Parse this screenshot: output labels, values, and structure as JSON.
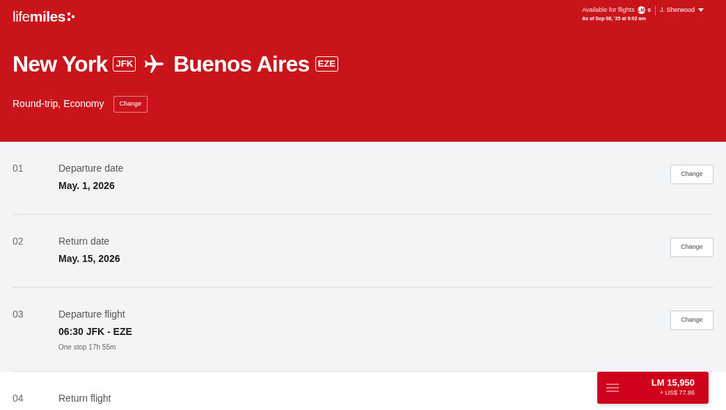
{
  "logo": "life**miles**",
  "account": {
    "availability_label": "Available for flights",
    "badge": "LM",
    "balance": "0",
    "as_of": "As of Sep 08, '25 at 9:02 am",
    "user": "J. Sherwood"
  },
  "route": {
    "origin": "New York",
    "origin_code": "JFK",
    "destination": "Buenos Aires",
    "destination_code": "EZE"
  },
  "trip": {
    "summary": "Round-trip, Economy",
    "button": "Change"
  },
  "steps": [
    {
      "number": "01",
      "title": "Departure date",
      "value": "May. 1, 2026",
      "completed": true,
      "button": "Change"
    },
    {
      "number": "02",
      "title": "Return date",
      "value": "May. 15, 2026",
      "completed": true,
      "button": "Change"
    },
    {
      "number": "03",
      "title": "Departure flight",
      "value": "06:30 JFK - EZE",
      "detail": "One stop 17h 55m",
      "completed": true,
      "button": "Change"
    },
    {
      "number": "04",
      "title": "Return flight",
      "completed": false
    }
  ],
  "price": {
    "miles": "LM 15,950",
    "cash": "+ US$ 77.86"
  }
}
